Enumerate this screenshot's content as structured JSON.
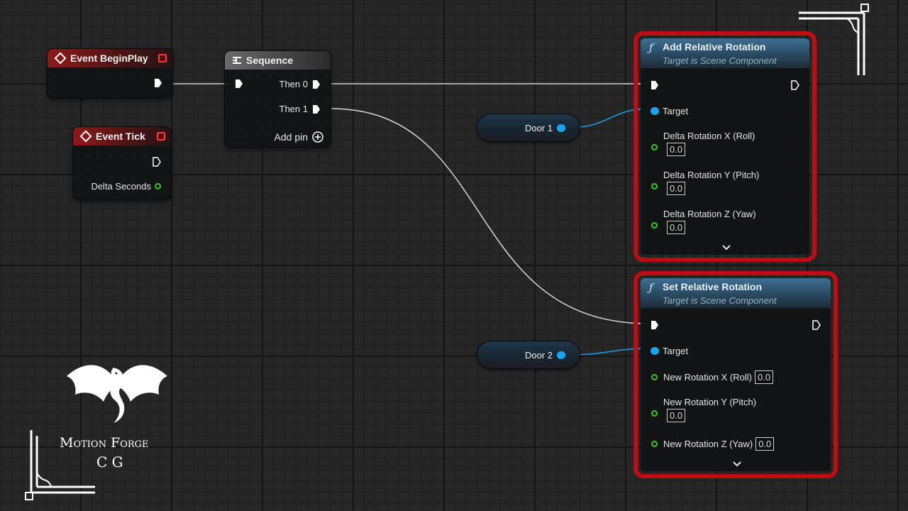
{
  "nodes": {
    "begin_play": {
      "title": "Event BeginPlay"
    },
    "event_tick": {
      "title": "Event Tick",
      "delta_seconds": "Delta Seconds"
    },
    "sequence": {
      "title": "Sequence",
      "then0": "Then 0",
      "then1": "Then 1",
      "add_pin": "Add pin"
    },
    "door1": {
      "label": "Door 1"
    },
    "door2": {
      "label": "Door 2"
    },
    "add_relative_rotation": {
      "title": "Add Relative Rotation",
      "subtitle": "Target is Scene Component",
      "target": "Target",
      "x_label": "Delta Rotation X (Roll)",
      "x_value": "0.0",
      "y_label": "Delta Rotation Y (Pitch)",
      "y_value": "0.0",
      "z_label": "Delta Rotation Z (Yaw)",
      "z_value": "0.0"
    },
    "set_relative_rotation": {
      "title": "Set Relative Rotation",
      "subtitle": "Target is Scene Component",
      "target": "Target",
      "x_label": "New Rotation X (Roll)",
      "x_value": "0.0",
      "y_label": "New Rotation Y (Pitch)",
      "y_value": "0.0",
      "z_label": "New Rotation Z (Yaw)",
      "z_value": "0.0"
    }
  },
  "branding": {
    "line1": "Motion Forge",
    "line2": "C G"
  },
  "colors": {
    "highlight": "#c00c12",
    "exec_pin": "#ffffff",
    "object_pin": "#1aa3ef",
    "float_pin": "#3ac81e",
    "event_header": "#8e1a1a",
    "function_header": "#3f6f92"
  }
}
